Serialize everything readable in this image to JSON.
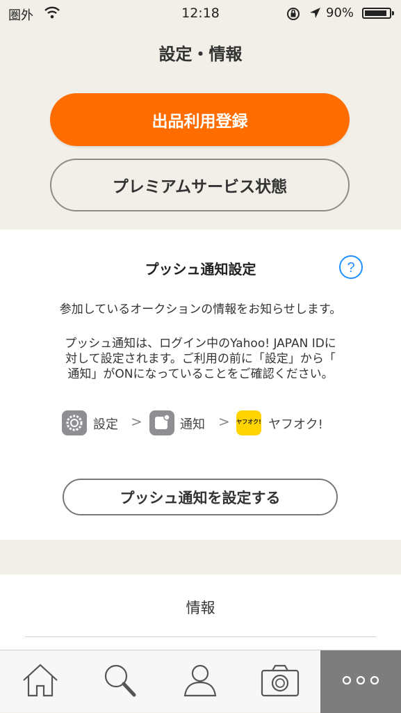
{
  "status_bar": {
    "carrier": "圏外",
    "time": "12:18",
    "battery": "90%",
    "battery_level": 0.9
  },
  "page": {
    "title": "設定・情報"
  },
  "actions": {
    "listing_registration": "出品利用登録",
    "premium_status": "プレミアムサービス状態"
  },
  "push": {
    "heading": "プッシュ通知設定",
    "description": "参加しているオークションの情報をお知らせします。",
    "note_lines": [
      "プッシュ通知は、ログイン中のYahoo! JAPAN IDに",
      "対して設定されます。ご利用の前に「設定」から「",
      "通知」がONになっていることをご確認ください。"
    ],
    "path": {
      "settings": "設定",
      "notifications": "通知",
      "app": "ヤフオク!",
      "app_icon_text": "ヤフオク!",
      "separator": ">"
    },
    "button": "プッシュ通知を設定する"
  },
  "info": {
    "title": "情報"
  },
  "tabbar": {
    "icons": [
      "home-icon",
      "search-icon",
      "profile-icon",
      "camera-icon",
      "more-icon"
    ],
    "more_label": "○○○"
  },
  "colors": {
    "accent": "#ff6c00",
    "background": "#f1efe7",
    "help_blue": "#1e90ff",
    "yahuoku_yellow": "#ffd400",
    "more_tab": "#7d7d7d"
  }
}
